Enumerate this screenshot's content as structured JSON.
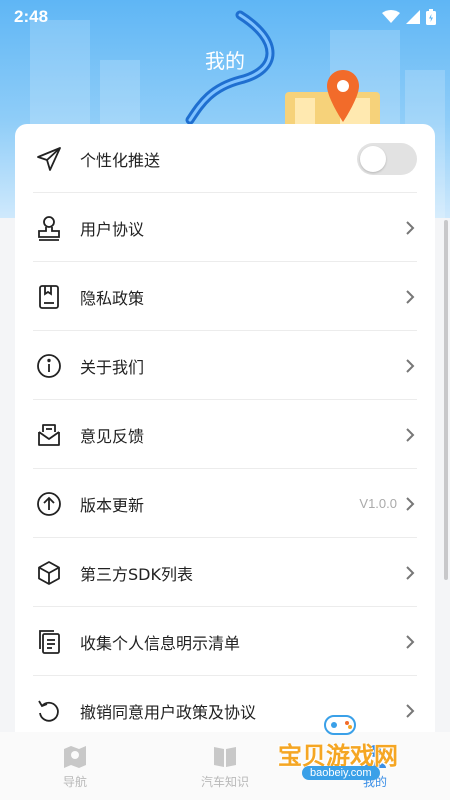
{
  "status_bar": {
    "time": "2:48"
  },
  "header": {
    "title": "我的"
  },
  "menu": {
    "items": [
      {
        "label": "个性化推送",
        "icon": "send-icon",
        "control": "toggle",
        "toggle_on": false
      },
      {
        "label": "用户协议",
        "icon": "stamp-icon"
      },
      {
        "label": "隐私政策",
        "icon": "document-icon"
      },
      {
        "label": "关于我们",
        "icon": "info-icon"
      },
      {
        "label": "意见反馈",
        "icon": "feedback-mail-icon"
      },
      {
        "label": "版本更新",
        "icon": "upgrade-icon",
        "value": "V1.0.0"
      },
      {
        "label": "第三方SDK列表",
        "icon": "cube-icon"
      },
      {
        "label": "收集个人信息明示清单",
        "icon": "list-copy-icon"
      },
      {
        "label": "撤销同意用户政策及协议",
        "icon": "undo-icon"
      }
    ]
  },
  "bottom_nav": {
    "items": [
      {
        "label": "导航",
        "icon": "map-pin-icon"
      },
      {
        "label": "汽车知识",
        "icon": "book-icon"
      },
      {
        "label": "我的",
        "icon": "user-icon"
      }
    ]
  },
  "watermark": {
    "text": "宝贝游戏网",
    "url": "baobeiy.com"
  },
  "colors": {
    "header": "#5fb6f5",
    "accent_pin": "#f26b2a",
    "text": "#222222",
    "muted": "#aaaaaa"
  }
}
